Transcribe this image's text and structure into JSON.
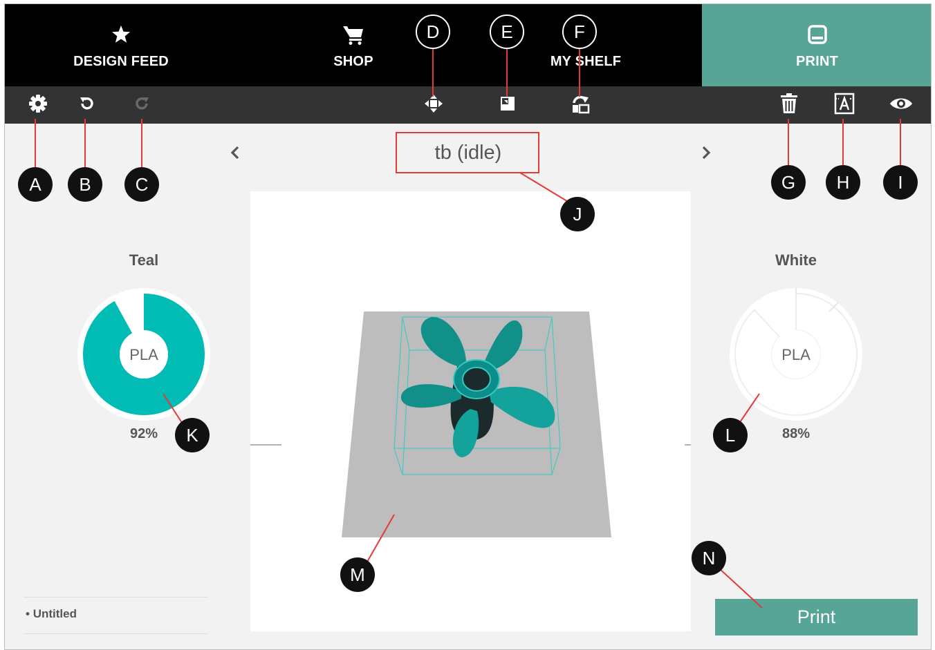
{
  "nav": {
    "tabs": [
      {
        "label": "DESIGN FEED",
        "icon": "star-icon"
      },
      {
        "label": "SHOP",
        "icon": "cart-icon"
      },
      {
        "label": "MY SHELF",
        "icon": "shelf-icon"
      },
      {
        "label": "PRINT",
        "icon": "printer-icon"
      }
    ],
    "active_color": "#56a596"
  },
  "toolbar": {
    "left": [
      "settings-icon",
      "undo-icon",
      "redo-icon"
    ],
    "center": [
      "move-icon",
      "scale-icon",
      "rotate-icon"
    ],
    "right": [
      "delete-icon",
      "label-icon",
      "view-icon"
    ]
  },
  "printer": {
    "status": "tb (idle)"
  },
  "materials": [
    {
      "name": "Teal",
      "type": "PLA",
      "percent": "92%",
      "fill": 0.92,
      "color": "#00bcb4"
    },
    {
      "name": "White",
      "type": "PLA",
      "percent": "88%",
      "fill": 0.88,
      "color": "#ffffff"
    }
  ],
  "project": {
    "item": "Untitled"
  },
  "actions": {
    "print": "Print"
  },
  "callouts": [
    "A",
    "B",
    "C",
    "D",
    "E",
    "F",
    "G",
    "H",
    "I",
    "J",
    "K",
    "L",
    "M",
    "N"
  ]
}
